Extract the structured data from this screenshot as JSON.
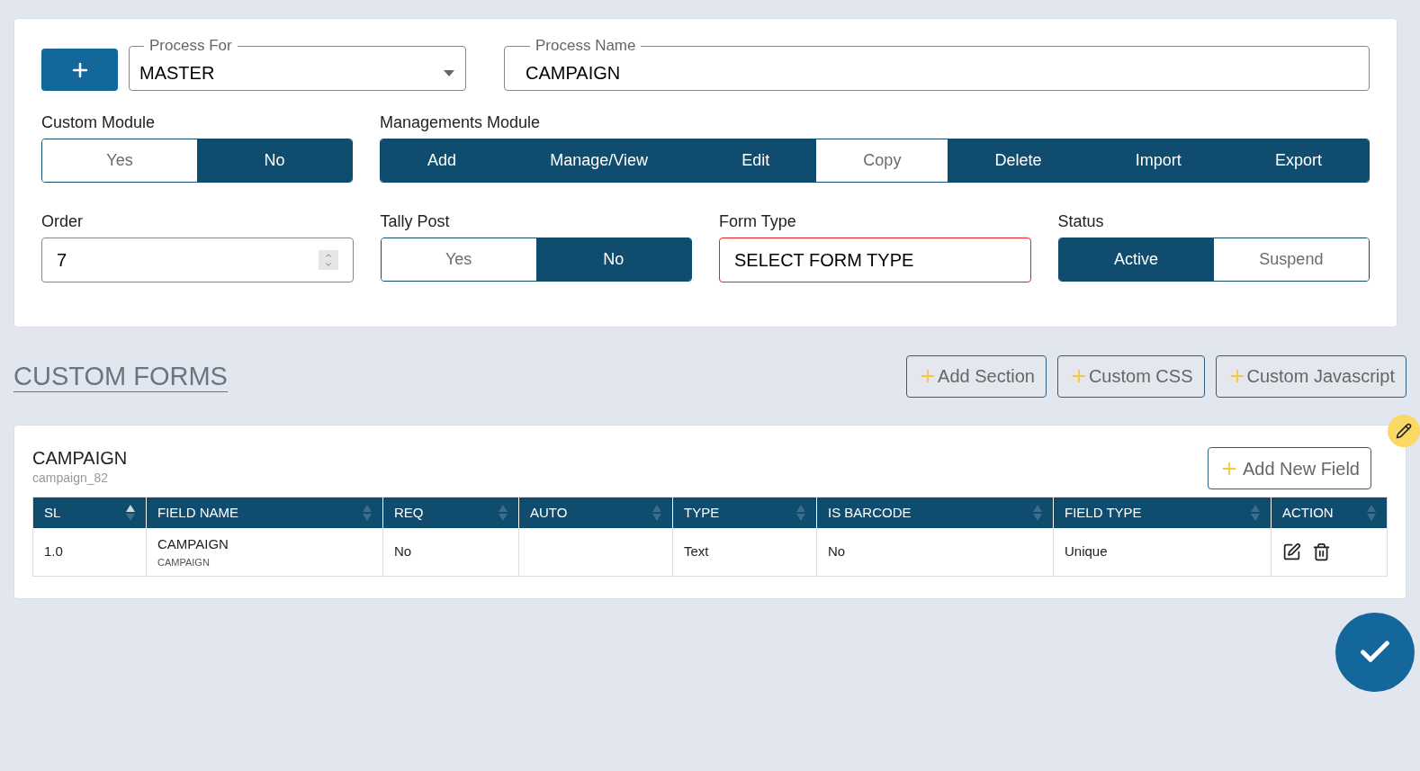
{
  "form": {
    "process_for": {
      "label": "Process For",
      "value": "MASTER"
    },
    "process_name": {
      "label": "Process Name",
      "value": "CAMPAIGN"
    },
    "custom_module": {
      "label": "Custom Module",
      "options": [
        {
          "label": "Yes",
          "selected": false
        },
        {
          "label": "No",
          "selected": true
        }
      ]
    },
    "managements_module": {
      "label": "Managements Module",
      "options": [
        {
          "label": "Add",
          "selected": true
        },
        {
          "label": "Manage/View",
          "selected": true
        },
        {
          "label": "Edit",
          "selected": true
        },
        {
          "label": "Copy",
          "selected": false
        },
        {
          "label": "Delete",
          "selected": true
        },
        {
          "label": "Import",
          "selected": true
        },
        {
          "label": "Export",
          "selected": true
        }
      ]
    },
    "order": {
      "label": "Order",
      "value": "7"
    },
    "tally_post": {
      "label": "Tally Post",
      "options": [
        {
          "label": "Yes",
          "selected": false
        },
        {
          "label": "No",
          "selected": true
        }
      ]
    },
    "form_type": {
      "label": "Form Type",
      "value": "SELECT FORM TYPE",
      "invalid": true
    },
    "status": {
      "label": "Status",
      "options": [
        {
          "label": "Active",
          "selected": true
        },
        {
          "label": "Suspend",
          "selected": false
        }
      ]
    }
  },
  "custom_forms": {
    "title": "CUSTOM FORMS",
    "buttons": [
      {
        "label": "Add Section"
      },
      {
        "label": "Custom CSS"
      },
      {
        "label": "Custom Javascript"
      }
    ]
  },
  "section": {
    "title": "CAMPAIGN",
    "subtitle": "campaign_82",
    "add_button": "Add New Field",
    "table": {
      "columns": [
        {
          "label": "SL",
          "sorted": true
        },
        {
          "label": "FIELD NAME",
          "sorted": false
        },
        {
          "label": "REQ",
          "sorted": false
        },
        {
          "label": "AUTO",
          "sorted": false
        },
        {
          "label": "TYPE",
          "sorted": false
        },
        {
          "label": "IS BARCODE",
          "sorted": false
        },
        {
          "label": "FIELD TYPE",
          "sorted": false
        },
        {
          "label": "ACTION",
          "sorted": false
        }
      ],
      "rows": [
        {
          "sl": "1.0",
          "field_name": "CAMPAIGN",
          "field_key": "CAMPAIGN",
          "req": "No",
          "type": "Text",
          "is_barcode": "No",
          "field_type": "Unique"
        }
      ]
    }
  }
}
